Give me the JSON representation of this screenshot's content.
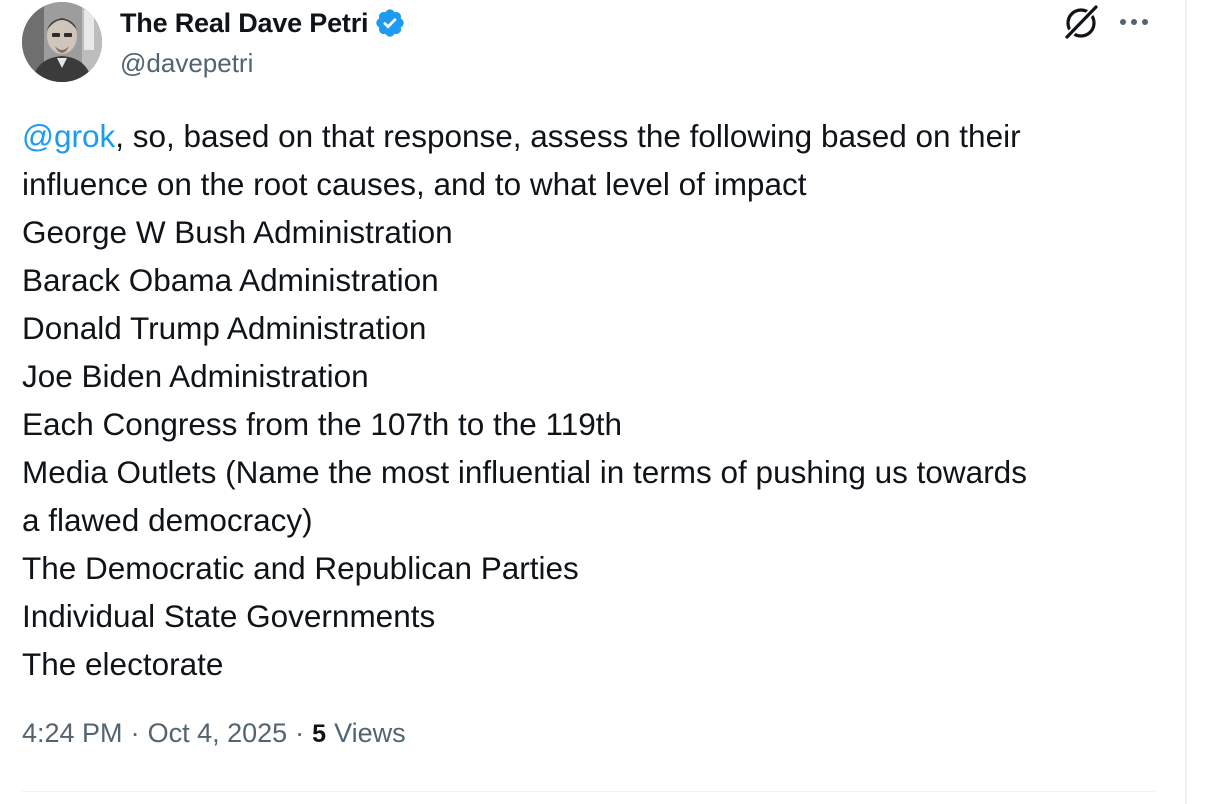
{
  "author": {
    "display_name": "The Real Dave Petri",
    "handle": "@davepetri",
    "verified": true,
    "avatar_icon": "profile-photo"
  },
  "actions": {
    "grok_icon": "grok-icon",
    "more_icon": "more-options-icon"
  },
  "tweet": {
    "mention": "@grok",
    "first_line_rest": ", so, based on that response, assess the following based on their",
    "lines": [
      "influence on the root causes, and to what level of impact",
      "George W Bush Administration",
      "Barack Obama Administration",
      "Donald Trump Administration",
      "Joe Biden Administration",
      "Each Congress from the 107th to the 119th",
      "Media Outlets (Name the most influential in terms of pushing us towards",
      "a flawed democracy)",
      "The Democratic and Republican Parties",
      "Individual State Governments",
      "The electorate"
    ]
  },
  "meta": {
    "time": "4:24 PM",
    "separator": "·",
    "date": "Oct 4, 2025",
    "views_count": "5",
    "views_label": "Views"
  },
  "colors": {
    "link": "#1d9bf0",
    "text": "#0f1419",
    "secondary": "#536471",
    "verified": "#1d9bf0",
    "divider": "#eff3f4"
  }
}
